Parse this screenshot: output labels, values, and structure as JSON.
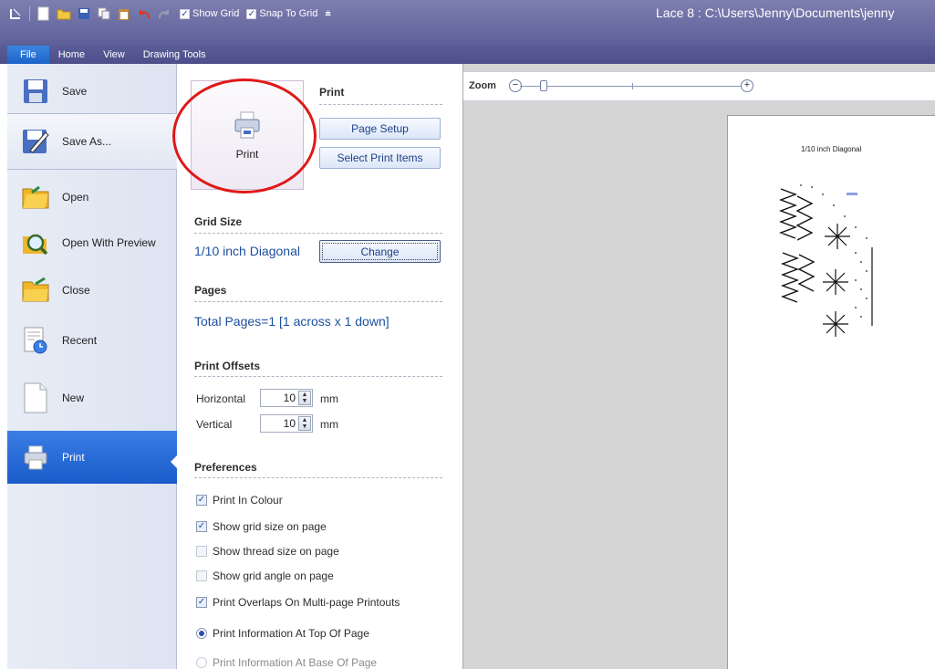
{
  "window": {
    "title": "Lace 8 : C:\\Users\\Jenny\\Documents\\jenny"
  },
  "qat": {
    "show_grid": "Show Grid",
    "snap_to_grid": "Snap To Grid"
  },
  "menu": {
    "tabs": [
      "File",
      "Home",
      "View",
      "Drawing Tools"
    ]
  },
  "file_menu": {
    "items": [
      {
        "label": "Save",
        "icon": "save-icon"
      },
      {
        "label": "Save As...",
        "icon": "save-as-icon"
      },
      {
        "label": "Open",
        "icon": "open-folder-icon"
      },
      {
        "label": "Open With Preview",
        "icon": "open-with-preview-icon"
      },
      {
        "label": "Close",
        "icon": "close-folder-icon"
      },
      {
        "label": "Recent",
        "icon": "recent-icon"
      },
      {
        "label": "New",
        "icon": "new-document-icon"
      },
      {
        "label": "Print",
        "icon": "printer-icon"
      }
    ]
  },
  "print_panel": {
    "print_header": "Print",
    "print_button": "Print",
    "page_setup": "Page Setup",
    "select_items": "Select Print Items",
    "grid_size_header": "Grid Size",
    "grid_size_value": "1/10 inch Diagonal",
    "change_button": "Change",
    "pages_header": "Pages",
    "pages_value": "Total Pages=1   [1 across x 1 down]",
    "offsets_header": "Print Offsets",
    "horizontal_label": "Horizontal",
    "horizontal_value": "10",
    "vertical_label": "Vertical",
    "vertical_value": "10",
    "unit": "mm",
    "preferences_header": "Preferences",
    "preferences": [
      {
        "label": "Print In Colour",
        "checked": true
      },
      {
        "label": "Show grid size on page",
        "checked": true
      },
      {
        "label": "Show thread size on page",
        "checked": false
      },
      {
        "label": "Show grid angle on page",
        "checked": false
      },
      {
        "label": "Print Overlaps On Multi-page Printouts",
        "checked": true
      }
    ],
    "info_position": [
      {
        "label": "Print Information At Top Of Page",
        "selected": true
      },
      {
        "label": "Print Information At Base Of Page",
        "selected": false
      }
    ]
  },
  "preview": {
    "zoom_label": "Zoom",
    "page_title": "1/10 inch Diagonal"
  },
  "colors": {
    "accent": "#1a5bc9",
    "highlight_circle": "#e01919"
  }
}
